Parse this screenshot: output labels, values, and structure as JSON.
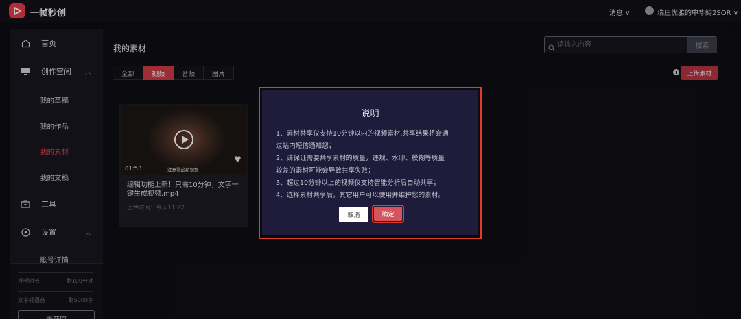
{
  "app": {
    "title": "一帧秒创"
  },
  "topbar": {
    "messages_label": "消息 ∨",
    "user_name": "瑞庄优雅的中华鲟2SOR ∨"
  },
  "sidebar": {
    "home": "首页",
    "create_space": "创作空间",
    "sub_items": [
      "我的草稿",
      "我的作品",
      "我的素材",
      "我的文稿"
    ],
    "active_sub": "我的素材",
    "tools": "工具",
    "settings": "设置",
    "account": "账号详情",
    "quota": {
      "video_label": "视频时长",
      "video_remaining": "剩100分钟",
      "tts_label": "文字转语音",
      "tts_remaining": "剩5000字",
      "get_more": "去获取"
    }
  },
  "main": {
    "title": "我的素材",
    "search": {
      "placeholder": "请输入内容",
      "button": "搜索"
    },
    "tabs": [
      "全部",
      "视频",
      "音频",
      "图片"
    ],
    "active_tab": "视频",
    "upload_button": "上传素材"
  },
  "card": {
    "duration": "01:53",
    "caption": "注意看这期视频",
    "title": "编辑功能上新！只需10分钟，文字一键生成视频.mp4",
    "upload_time": "上传时间：今天11:22"
  },
  "modal": {
    "title": "说明",
    "lines": [
      "1、素材共享仅支持10分钟以内的视频素材,共享结果将会通",
      "过站内短信通知您；",
      "2、请保证需要共享素材的质量，违规、水印、模糊等质量",
      "较差的素材可能会导致共享失败；",
      "3、超过10分钟以上的视频仅支持智能分析后自动共享；",
      "4、选择素材共享后，其它用户可以使用并维护您的素材。"
    ],
    "cancel": "取消",
    "confirm": "确定"
  }
}
